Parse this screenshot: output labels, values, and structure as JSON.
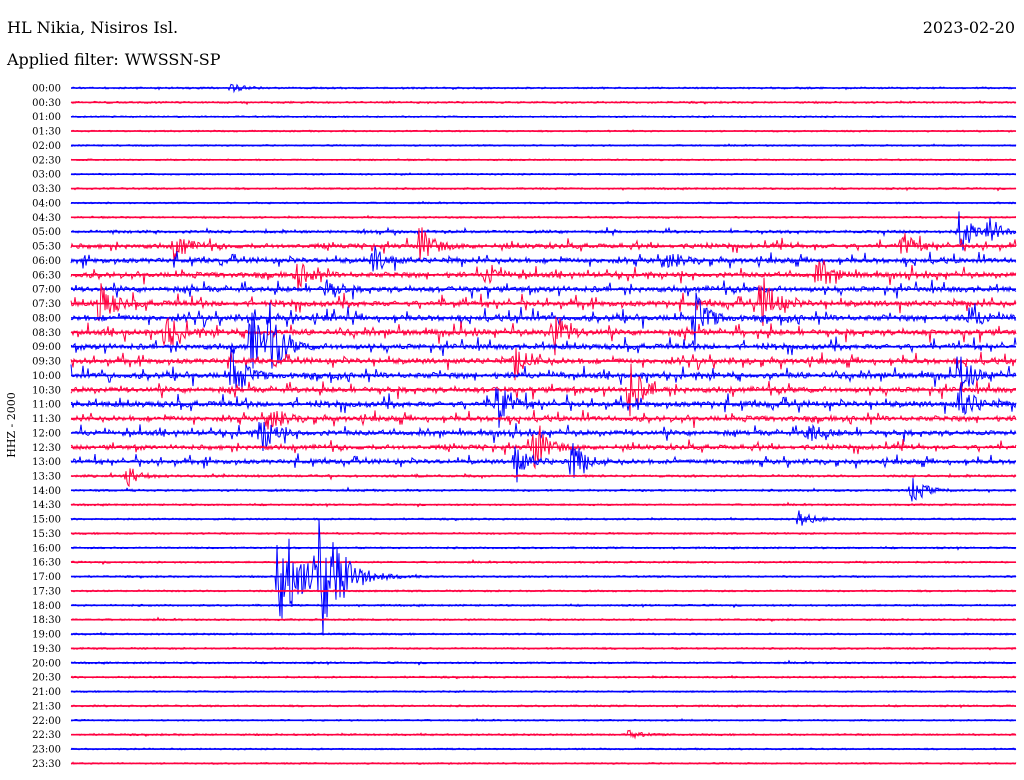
{
  "header": {
    "station": "HL Nikia, Nisiros Isl.",
    "date": "2023-02-20",
    "filter_label": "Applied filter:",
    "filter_value": "WWSSN-SP"
  },
  "colors": {
    "trace_a": "#0000ff",
    "trace_b": "#ff0040",
    "text": "#000000",
    "background": "#ffffff"
  },
  "chart_data": {
    "type": "line",
    "ylabel": "HHZ - 2000",
    "row_labels": [
      "00:00",
      "00:30",
      "01:00",
      "01:30",
      "02:00",
      "02:30",
      "03:00",
      "03:30",
      "04:00",
      "04:30",
      "05:00",
      "05:30",
      "06:00",
      "06:30",
      "07:00",
      "07:30",
      "08:00",
      "08:30",
      "09:00",
      "09:30",
      "10:00",
      "10:30",
      "11:00",
      "11:30",
      "12:00",
      "12:30",
      "13:00",
      "13:30",
      "14:00",
      "14:30",
      "15:00",
      "15:30",
      "16:00",
      "16:30",
      "17:00",
      "17:30",
      "18:00",
      "18:30",
      "19:00",
      "19:30",
      "20:00",
      "20:30",
      "21:00",
      "21:30",
      "22:00",
      "22:30",
      "23:00",
      "23:30"
    ],
    "series_colors_alternating": [
      "blue",
      "red"
    ],
    "row_activity": [
      0.1,
      0.1,
      0.05,
      0.05,
      0.05,
      0.05,
      0.05,
      0.1,
      0.05,
      0.1,
      0.3,
      0.6,
      0.7,
      0.7,
      0.75,
      0.8,
      0.8,
      0.8,
      0.75,
      0.75,
      0.8,
      0.75,
      0.8,
      0.7,
      0.7,
      0.6,
      0.6,
      0.2,
      0.15,
      0.1,
      0.1,
      0.1,
      0.1,
      0.1,
      0.1,
      0.1,
      0.1,
      0.1,
      0.1,
      0.1,
      0.1,
      0.1,
      0.05,
      0.1,
      0.05,
      0.1,
      0.05,
      0.05
    ],
    "events": [
      {
        "row": 0,
        "t": 0.17,
        "amp": 4
      },
      {
        "row": 10,
        "t": 0.94,
        "amp": 24
      },
      {
        "row": 10,
        "t": 0.97,
        "amp": 16
      },
      {
        "row": 11,
        "t": 0.11,
        "amp": 14
      },
      {
        "row": 11,
        "t": 0.37,
        "amp": 20
      },
      {
        "row": 11,
        "t": 0.88,
        "amp": 14
      },
      {
        "row": 12,
        "t": 0.32,
        "amp": 14
      },
      {
        "row": 12,
        "t": 0.63,
        "amp": 10
      },
      {
        "row": 13,
        "t": 0.24,
        "amp": 14
      },
      {
        "row": 13,
        "t": 0.44,
        "amp": 12
      },
      {
        "row": 13,
        "t": 0.79,
        "amp": 18
      },
      {
        "row": 14,
        "t": 0.27,
        "amp": 10
      },
      {
        "row": 15,
        "t": 0.03,
        "amp": 22
      },
      {
        "row": 15,
        "t": 0.73,
        "amp": 30
      },
      {
        "row": 16,
        "t": 0.66,
        "amp": 26
      },
      {
        "row": 16,
        "t": 0.95,
        "amp": 12
      },
      {
        "row": 17,
        "t": 0.1,
        "amp": 20
      },
      {
        "row": 17,
        "t": 0.51,
        "amp": 26
      },
      {
        "row": 18,
        "t": 0.19,
        "amp": 40
      },
      {
        "row": 18,
        "t": 0.21,
        "amp": 30
      },
      {
        "row": 19,
        "t": 0.47,
        "amp": 16
      },
      {
        "row": 20,
        "t": 0.17,
        "amp": 28
      },
      {
        "row": 20,
        "t": 0.94,
        "amp": 20
      },
      {
        "row": 21,
        "t": 0.59,
        "amp": 30
      },
      {
        "row": 22,
        "t": 0.45,
        "amp": 26
      },
      {
        "row": 22,
        "t": 0.94,
        "amp": 22
      },
      {
        "row": 23,
        "t": 0.21,
        "amp": 14
      },
      {
        "row": 24,
        "t": 0.2,
        "amp": 22
      },
      {
        "row": 24,
        "t": 0.78,
        "amp": 12
      },
      {
        "row": 25,
        "t": 0.49,
        "amp": 26
      },
      {
        "row": 26,
        "t": 0.47,
        "amp": 18
      },
      {
        "row": 26,
        "t": 0.53,
        "amp": 22
      },
      {
        "row": 27,
        "t": 0.06,
        "amp": 10
      },
      {
        "row": 28,
        "t": 0.89,
        "amp": 14
      },
      {
        "row": 30,
        "t": 0.77,
        "amp": 9
      },
      {
        "row": 34,
        "t": 0.22,
        "amp": 65
      },
      {
        "row": 34,
        "t": 0.26,
        "amp": 80
      },
      {
        "row": 45,
        "t": 0.59,
        "amp": 4
      }
    ],
    "grid": false,
    "legend": "none"
  }
}
